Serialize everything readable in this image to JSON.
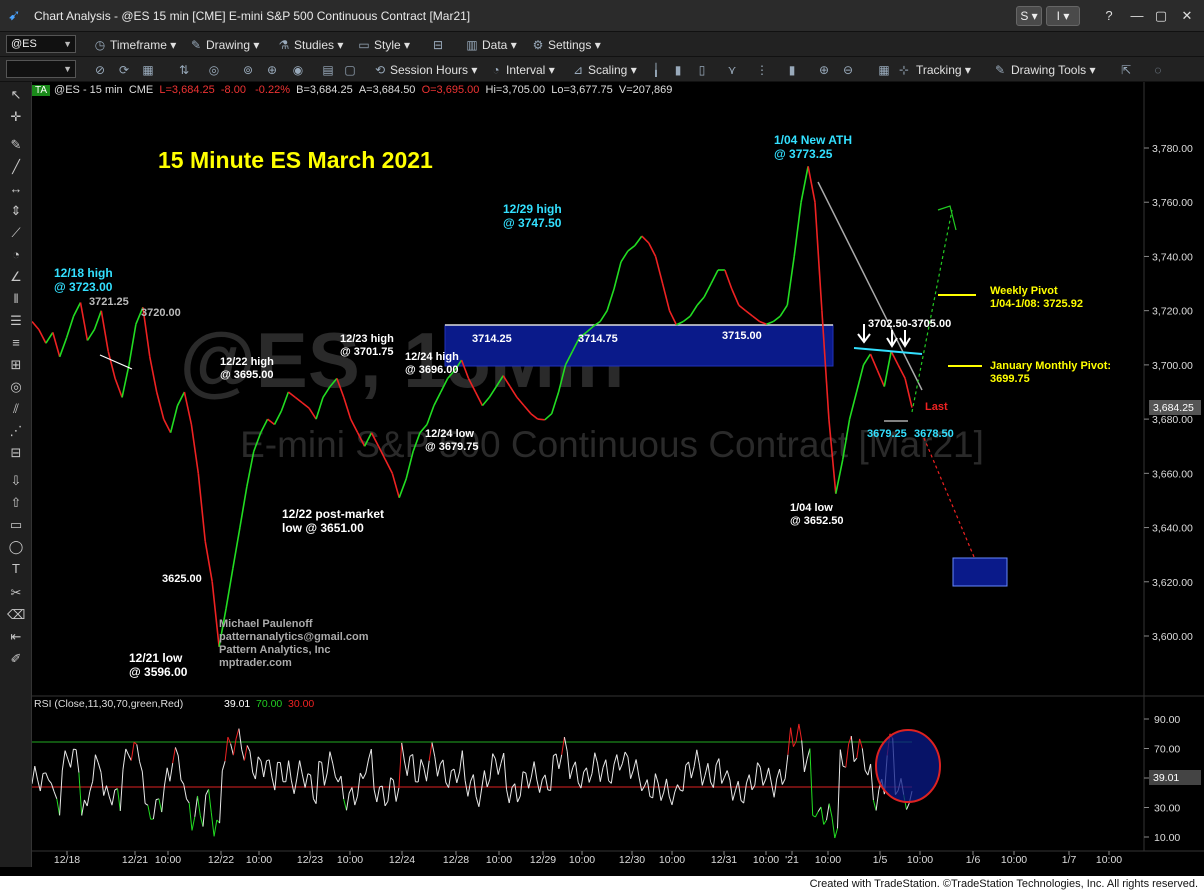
{
  "window": {
    "title": "Chart Analysis - @ES 15 min [CME] E-mini S&P 500 Continuous Contract [Mar21]",
    "btn_s": "S",
    "btn_i": "I"
  },
  "toolbar": {
    "symbol": "@ES",
    "timeframe": "Timeframe",
    "drawing": "Drawing",
    "studies": "Studies",
    "style": "Style",
    "data": "Data",
    "settings": "Settings",
    "session_hours": "Session Hours",
    "interval": "Interval",
    "scaling": "Scaling",
    "tracking": "Tracking",
    "drawing_tools": "Drawing Tools"
  },
  "header": {
    "badge": "TA",
    "symbol": "@ES - 15 min",
    "exch": "CME",
    "l": "L=3,684.25",
    "chg": "-8.00",
    "pct": "-0.22%",
    "b": "B=3,684.25",
    "a": "A=3,684.50",
    "o": "O=3,695.00",
    "hi": "Hi=3,705.00",
    "lo": "Lo=3,677.75",
    "v": "V=207,869"
  },
  "watermark": {
    "big": "@ES, 15Min",
    "sub": "E-mini S&P 500 Continuous Contract [Mar21]"
  },
  "colors": {
    "up": "#22dd22",
    "down": "#ee2222",
    "cyan": "#33e0ff",
    "yellow": "#ffff00",
    "zone": "#0a1a8a"
  },
  "annotations": {
    "main_title": "15 Minute ES March 2021",
    "a1218": "12/18 high",
    "a1218b": "@ 3723.00",
    "p372125": "3721.25",
    "p3720": "3720.00",
    "a1229": "12/29 high",
    "a1229b": "@ 3747.50",
    "a104ath": "1/04 New ATH",
    "a104athb": "@ 3773.25",
    "a1222h": "12/22 high",
    "a1222hb": "@ 3695.00",
    "a1223h": "12/23 high",
    "a1223hb": "@ 3701.75",
    "a1224h": "12/24 high",
    "a1224hb": "@ 3696.00",
    "a1224l": "12/24 low",
    "a1224lb": "@ 3679.75",
    "p371425": "3714.25",
    "p371475": "3714.75",
    "p3715": "3715.00",
    "p3702": "3702.50-3705.00",
    "weekly1": "Weekly Pivot",
    "weekly2": "1/04-1/08: 3725.92",
    "jan1": "January Monthly Pivot:",
    "jan2": "3699.75",
    "last": "Last",
    "p367925": "3679.25",
    "p367850": "3678.50",
    "a104l": "1/04 low",
    "a104lb": "@ 3652.50",
    "a1222p": "12/22 post-market",
    "a1222pb": "low @ 3651.00",
    "p3625": "3625.00",
    "a1221": "12/21 low",
    "a1221b": "@ 3596.00",
    "author1": "Michael Paulenoff",
    "author2": "patternanalytics@gmail.com",
    "author3": "Pattern Analytics, Inc",
    "author4": "mptrader.com"
  },
  "yaxis": {
    "price_ticks": [
      "3,780.00",
      "3,760.00",
      "3,740.00",
      "3,720.00",
      "3,700.00",
      "3,680.00",
      "3,660.00",
      "3,640.00",
      "3,620.00",
      "3,600.00"
    ],
    "last_price": "3,684.25",
    "rsi_ticks": [
      "90.00",
      "70.00",
      "50.00",
      "30.00",
      "10.00"
    ],
    "rsi_last": "39.01"
  },
  "xaxis": {
    "labels": [
      "12/18",
      "12/21",
      "10:00",
      "12/22",
      "10:00",
      "12/23",
      "10:00",
      "12/24",
      "12/28",
      "10:00",
      "12/29",
      "10:00",
      "12/30",
      "10:00",
      "12/31",
      "10:00",
      "'21",
      "10:00",
      "1/5",
      "10:00",
      "1/6",
      "10:00",
      "1/7",
      "10:00"
    ]
  },
  "rsi": {
    "label": "RSI (Close,11,30,70,green,Red)",
    "value": "39.01",
    "ob": "70.00",
    "os": "30.00"
  },
  "credit": "Created with TradeStation. ©TradeStation Technologies, Inc. All rights reserved.",
  "chart_data": {
    "type": "line",
    "title": "15 Minute ES March 2021",
    "ylim": [
      3588,
      3792
    ],
    "series": [
      {
        "values": [
          3716,
          3713,
          3708,
          3712,
          3703,
          3710,
          3718,
          3723,
          3709,
          3713,
          3720,
          3705,
          3695,
          3688,
          3700,
          3715,
          3721.25,
          3703,
          3690,
          3680,
          3675,
          3685,
          3690,
          3678,
          3660,
          3635,
          3620,
          3596,
          3610,
          3625,
          3640,
          3655,
          3668,
          3675,
          3680,
          3678,
          3683,
          3690,
          3688,
          3686,
          3684,
          3680,
          3688,
          3692,
          3695,
          3688,
          3680,
          3675,
          3670,
          3675,
          3670,
          3665,
          3660,
          3651,
          3658,
          3668,
          3675,
          3678,
          3685,
          3690,
          3695,
          3698,
          3701.75,
          3695,
          3690,
          3685,
          3688,
          3692,
          3696,
          3692,
          3688,
          3685,
          3682,
          3680,
          3679.75,
          3682,
          3690,
          3700,
          3705,
          3710,
          3712,
          3714.25,
          3716,
          3720,
          3728,
          3738,
          3742,
          3744,
          3747.5,
          3745,
          3740,
          3730,
          3720,
          3714.75,
          3716,
          3718,
          3722,
          3725,
          3730,
          3735,
          3735,
          3728,
          3722,
          3720,
          3718,
          3716,
          3715,
          3716,
          3718,
          3722,
          3740,
          3760,
          3773.25,
          3760,
          3720,
          3680,
          3652.5,
          3665,
          3680,
          3690,
          3700,
          3704,
          3698,
          3692,
          3705,
          3700,
          3695,
          3684.25
        ]
      }
    ],
    "xtick_labels": [
      "12/18",
      "12/21",
      "10:00",
      "12/22",
      "10:00",
      "12/23",
      "10:00",
      "12/24",
      "12/28",
      "10:00",
      "12/29",
      "10:00",
      "12/30",
      "10:00",
      "12/31",
      "10:00",
      "'21",
      "10:00",
      "1/5",
      "10:00",
      "1/6",
      "10:00",
      "1/7",
      "10:00"
    ],
    "levels": {
      "resistance_zone": [
        3699.75,
        3715.0
      ],
      "weekly_pivot": 3725.92,
      "monthly_pivot": 3699.75,
      "target_box": [
        3620,
        3630
      ]
    },
    "rsi": {
      "ylim": [
        0,
        100
      ],
      "overbought": 70,
      "oversold": 30,
      "last": 39.01
    },
    "grid": false,
    "legend": "none"
  }
}
